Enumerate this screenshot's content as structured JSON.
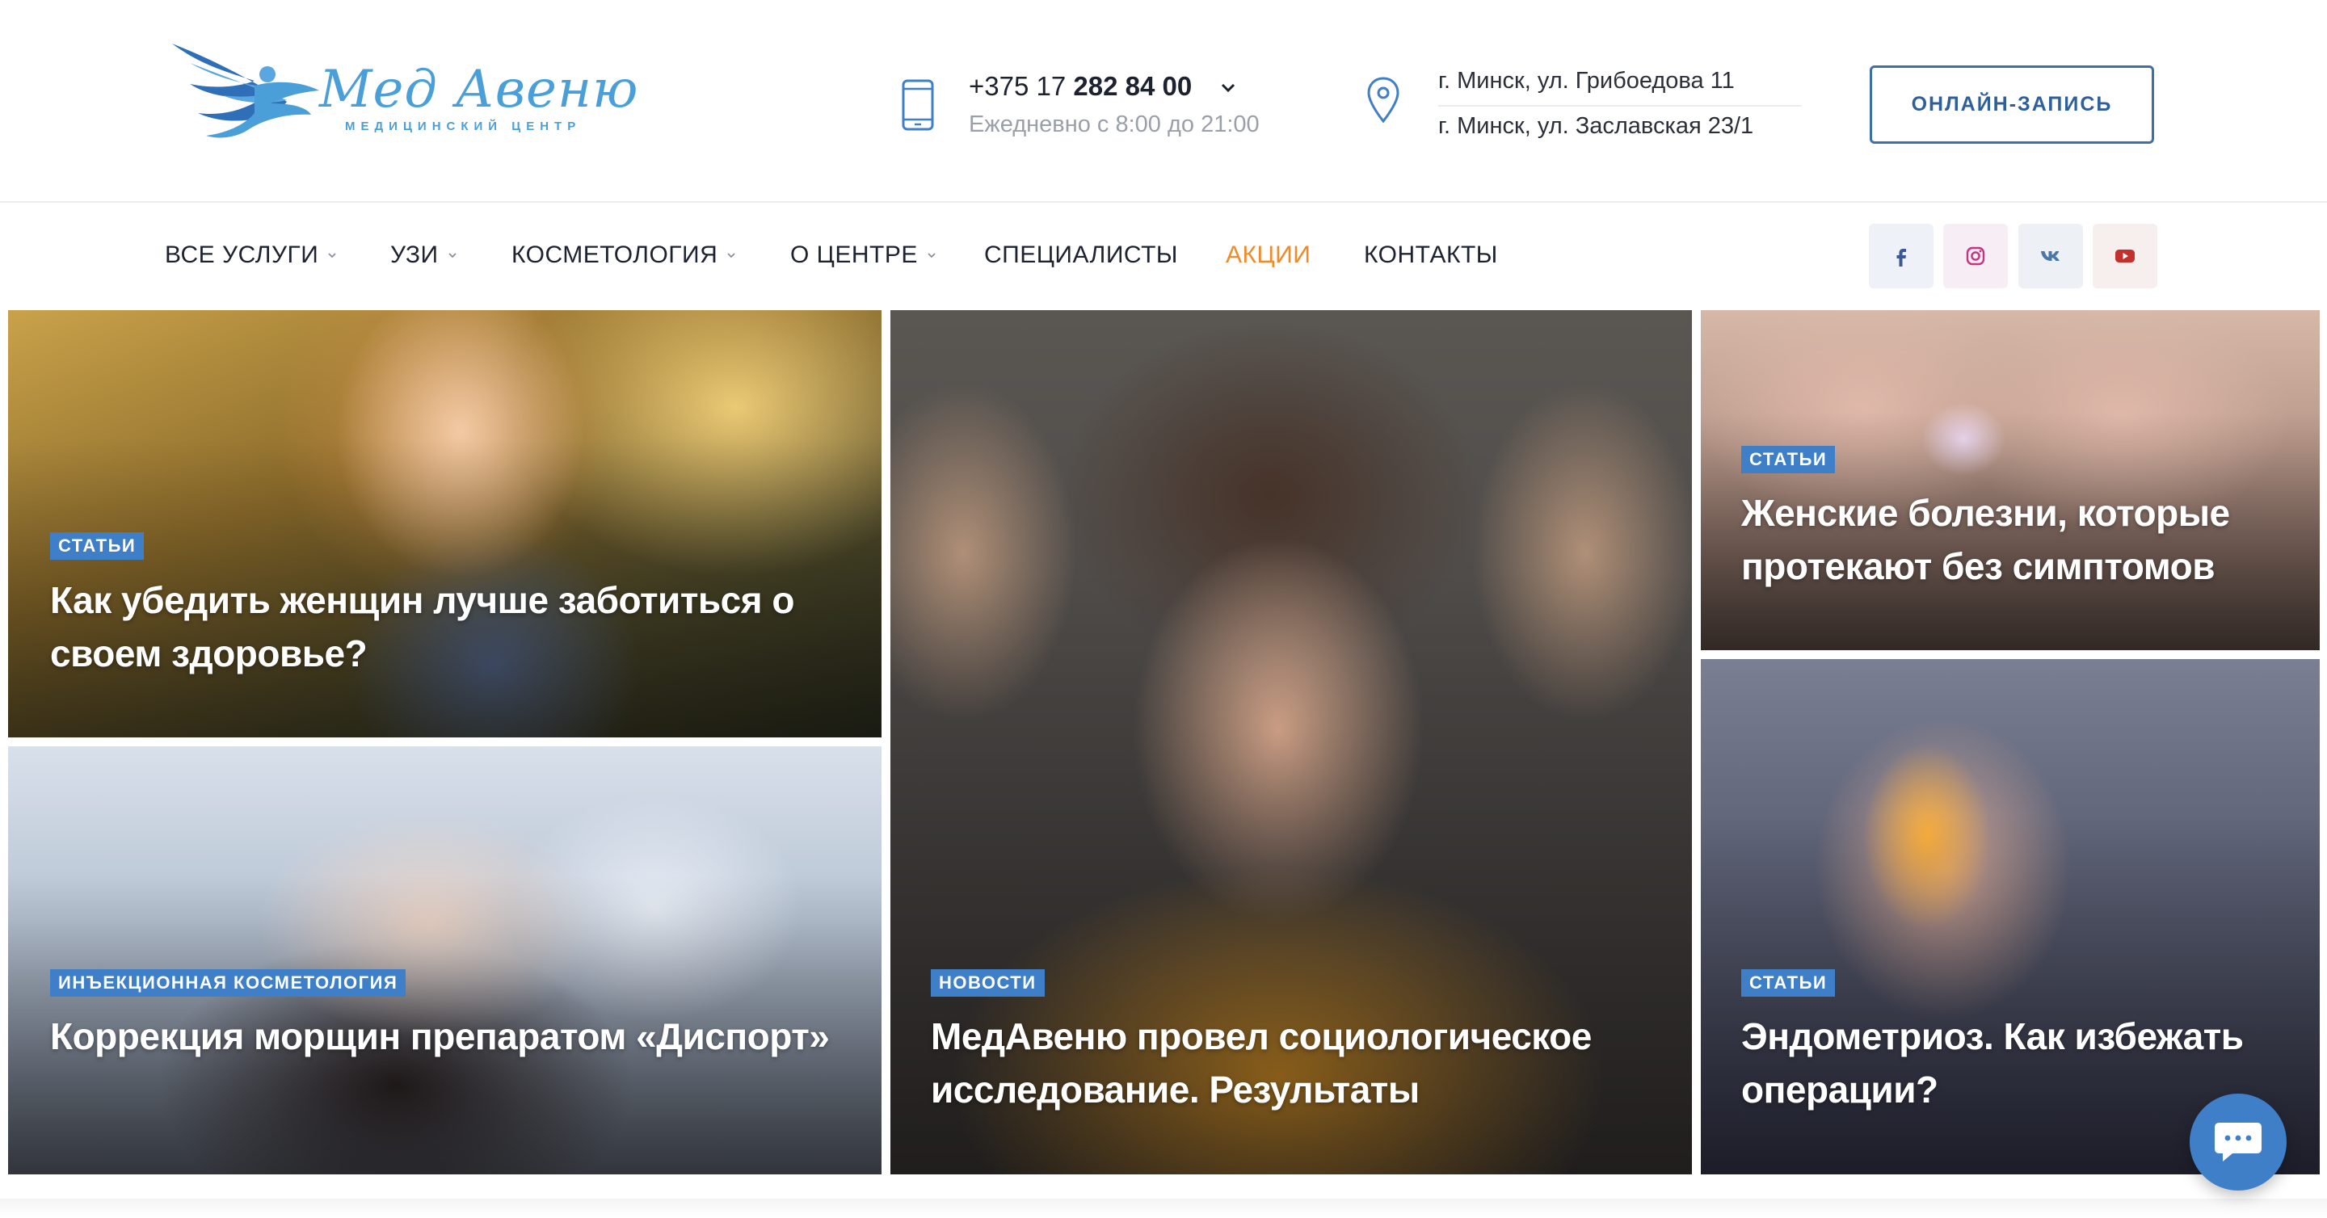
{
  "brand": {
    "logo_title": "Мед Авеню",
    "logo_subtitle": "МЕДИЦИНСКИЙ ЦЕНТР",
    "brand_color": "#4a9fd8"
  },
  "contacts": {
    "phone_prefix": "+375 17",
    "phone_main": "282 84 00",
    "hours": "Ежедневно с 8:00 до 21:00",
    "address_1": "г. Минск, ул. Грибоедова 11",
    "address_2": "г. Минск, ул. Заславская 23/1"
  },
  "cta": {
    "label": "ОНЛАЙН-ЗАПИСЬ"
  },
  "nav": {
    "items": [
      {
        "label": "ВСЕ УСЛУГИ",
        "dropdown": true
      },
      {
        "label": "УЗИ",
        "dropdown": true
      },
      {
        "label": "КОСМЕТОЛОГИЯ",
        "dropdown": true
      },
      {
        "label": "О ЦЕНТРЕ",
        "dropdown": true
      },
      {
        "label": "СПЕЦИАЛИСТЫ",
        "dropdown": false
      },
      {
        "label": "АКЦИИ",
        "dropdown": false,
        "accent": "#f08a2a"
      },
      {
        "label": "КОНТАКТЫ",
        "dropdown": false
      }
    ]
  },
  "social": [
    {
      "icon": "facebook-icon",
      "color": "#3b5998"
    },
    {
      "icon": "instagram-icon",
      "color": "#c13584"
    },
    {
      "icon": "vk-icon",
      "color": "#4a76a8"
    },
    {
      "icon": "youtube-icon",
      "color": "#c4302b"
    }
  ],
  "articles": [
    {
      "tag": "СТАТЬИ",
      "title": "Как убедить женщин лучше заботиться о своем здоровье?"
    },
    {
      "tag": "ИНЪЕКЦИОННАЯ КОСМЕТОЛОГИЯ",
      "title": "Коррекция морщин препаратом «Диспорт»"
    },
    {
      "tag": "НОВОСТИ",
      "title": "МедАвеню провел социологическое исследование. Результаты"
    },
    {
      "tag": "СТАТЬИ",
      "title": "Женские болезни, которые протекают без симптомов"
    },
    {
      "tag": "СТАТЬИ",
      "title": "Эндометриоз. Как избежать операции?"
    }
  ],
  "chat": {
    "icon": "chat-icon",
    "color": "#3f7fc8"
  }
}
